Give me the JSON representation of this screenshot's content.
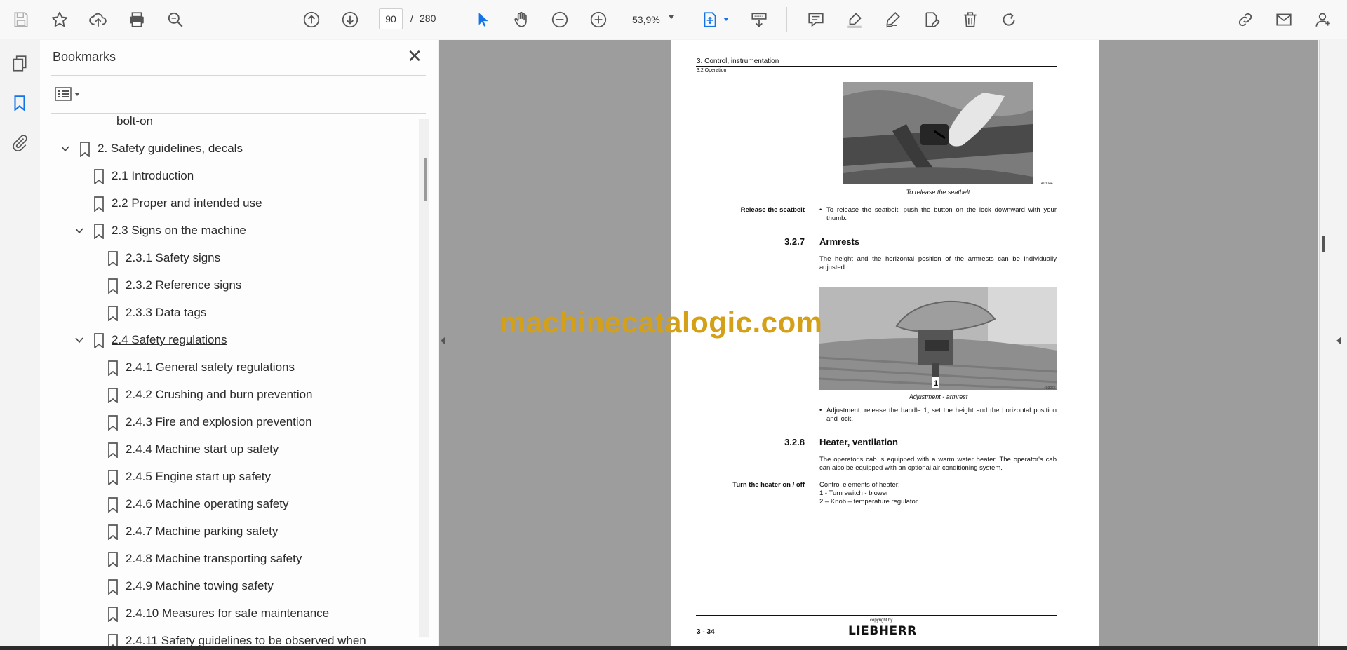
{
  "toolbar": {
    "page_current": "90",
    "page_separator": "/",
    "page_total": "280",
    "zoom": "53,9%",
    "icons": [
      "save-icon",
      "star-icon",
      "upload-icon",
      "print-icon",
      "zoom-search-icon",
      "page-up-icon",
      "page-down-icon",
      "select-arrow-icon",
      "hand-icon",
      "zoom-out-icon",
      "zoom-in-icon",
      "fit-page-icon",
      "scroll-mode-icon",
      "comment-icon",
      "highlight-icon",
      "sign-icon",
      "edit-page-icon",
      "delete-icon",
      "rotate-icon",
      "share-link-icon",
      "mail-icon",
      "account-icon"
    ]
  },
  "bookmarks": {
    "title": "Bookmarks",
    "items": [
      {
        "label": "bolt-on",
        "level": 3,
        "chevron": false
      },
      {
        "label": "2. Safety guidelines, decals",
        "level": 0,
        "chevron": true
      },
      {
        "label": "2.1 Introduction",
        "level": 1,
        "chevron": false
      },
      {
        "label": "2.2 Proper and intended use",
        "level": 1,
        "chevron": false
      },
      {
        "label": "2.3 Signs on the machine",
        "level": 1,
        "chevron": true
      },
      {
        "label": "2.3.1 Safety signs",
        "level": 2,
        "chevron": false
      },
      {
        "label": "2.3.2 Reference signs",
        "level": 2,
        "chevron": false
      },
      {
        "label": "2.3.3 Data tags",
        "level": 2,
        "chevron": false
      },
      {
        "label": "2.4 Safety regulations",
        "level": 1,
        "chevron": true,
        "underlined": true
      },
      {
        "label": "2.4.1 General safety regulations",
        "level": 2,
        "chevron": false
      },
      {
        "label": "2.4.2 Crushing and burn prevention",
        "level": 2,
        "chevron": false
      },
      {
        "label": "2.4.3 Fire and explosion prevention",
        "level": 2,
        "chevron": false
      },
      {
        "label": "2.4.4 Machine start up safety",
        "level": 2,
        "chevron": false
      },
      {
        "label": "2.4.5 Engine start up safety",
        "level": 2,
        "chevron": false
      },
      {
        "label": "2.4.6 Machine operating safety",
        "level": 2,
        "chevron": false
      },
      {
        "label": "2.4.7 Machine parking safety",
        "level": 2,
        "chevron": false
      },
      {
        "label": "2.4.8 Machine transporting safety",
        "level": 2,
        "chevron": false
      },
      {
        "label": "2.4.9 Machine towing safety",
        "level": 2,
        "chevron": false
      },
      {
        "label": "2.4.10 Measures for safe maintenance",
        "level": 2,
        "chevron": false
      },
      {
        "label": "2.4.11 Safety guidelines to be observed when",
        "level": 2,
        "chevron": false
      }
    ]
  },
  "document": {
    "header_title": "3. Control, instrumentation",
    "header_sub": "3.2 Operation",
    "fig1_id": "403044",
    "fig1_caption": "To release the seatbelt",
    "release_label": "Release the seatbelt",
    "release_bullet": "To release the seatbelt: push the button on the lock downward with your thumb.",
    "sec1_num": "3.2.7",
    "sec1_title": "Armrests",
    "sec1_text": "The height and the horizontal position of the armrests can be individually adjusted.",
    "fig2_label": "1",
    "fig2_id": "403066",
    "fig2_caption": "Adjustment - armrest",
    "adjust_bullet": "Adjustment: release the handle 1, set the height and the horizontal position and lock.",
    "sec2_num": "3.2.8",
    "sec2_title": "Heater, ventilation",
    "sec2_text": "The operator's cab is equipped with a warm water heater. The operator's cab can also be equipped with an optional air conditioning system.",
    "heater_label": "Turn the heater on / off",
    "heater_line1": "Control elements of heater:",
    "heater_line2": "1 - Turn switch - blower",
    "heater_line3": "2 – Knob – temperature regulator",
    "footer_copyright": "copyright by",
    "footer_logo": "LIEBHERR",
    "footer_page": "3 - 34"
  },
  "watermark": "machinecatalogic.com"
}
